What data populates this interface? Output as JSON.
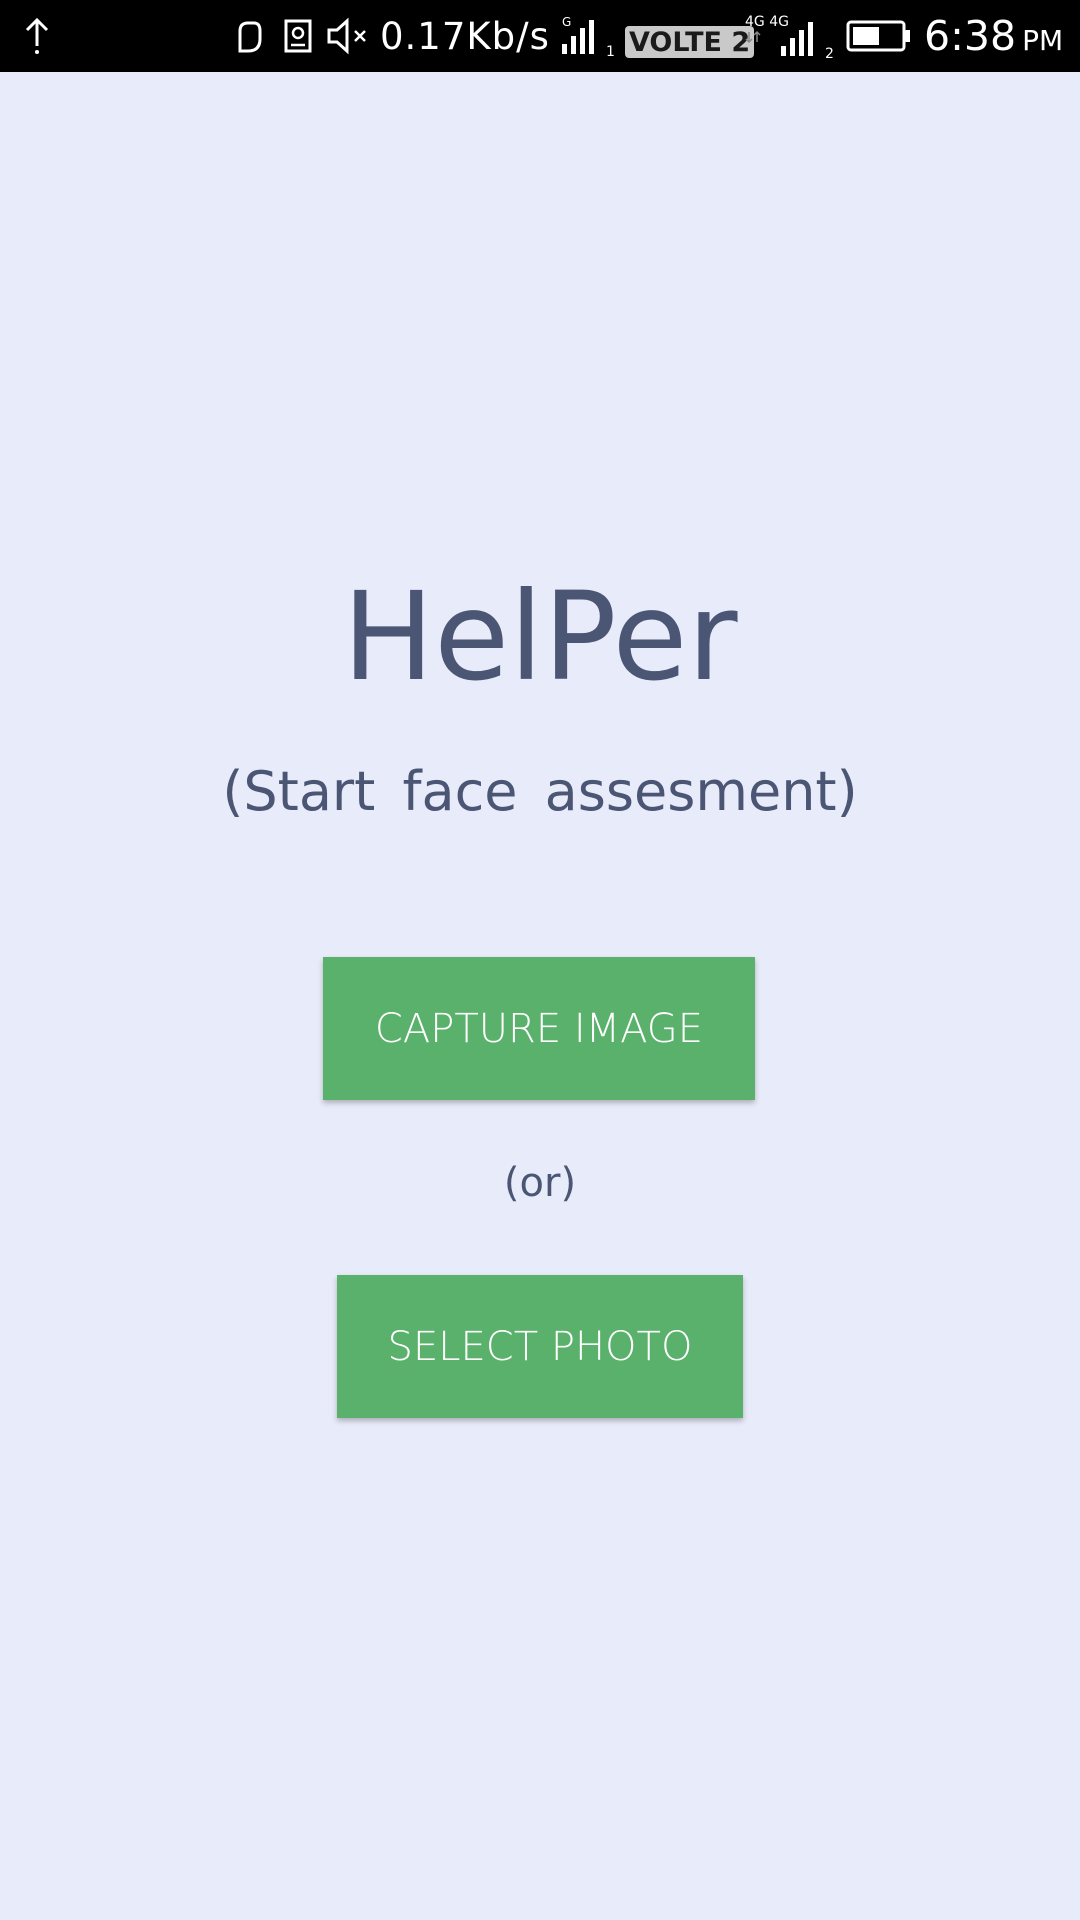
{
  "status_bar": {
    "upload_icon": "upload-arrow-icon",
    "hand_icon": "hand-icon",
    "photo_icon": "photo-frame-icon",
    "mute_icon": "speaker-muted-icon",
    "network_speed": "0.17Kb/s",
    "sim1_tech": "G",
    "sim1_index": "1",
    "volte_label": "VOLTE 2",
    "sim2_tech": "4G 4G",
    "sim2_index": "2",
    "battery_icon": "battery-icon",
    "time": "6:38",
    "ampm": "PM"
  },
  "main": {
    "title": "HelPer",
    "subtitle": "(Start face assesment)",
    "capture_button_label": "CAPTURE IMAGE",
    "or_label": "(or)",
    "select_button_label": "SELECT PHOTO"
  },
  "colors": {
    "background": "#e8ebf9",
    "text": "#4b5574",
    "button": "#59b16b",
    "status_bar": "#000000"
  }
}
